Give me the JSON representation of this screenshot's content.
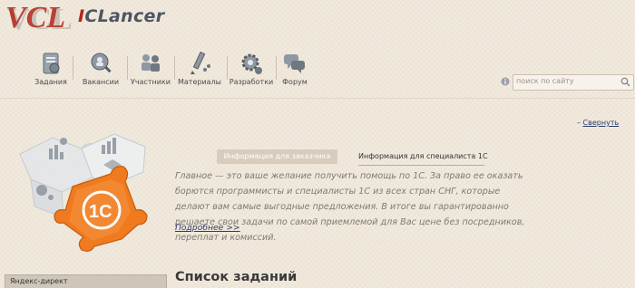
{
  "logo": {
    "text": "ICLancer",
    "first_letter": "I",
    "rest": "CLancer"
  },
  "nav": {
    "items": [
      {
        "label": "Задания",
        "icon": "tasks-icon"
      },
      {
        "label": "Вакансии",
        "icon": "vacancies-icon"
      },
      {
        "label": "Участники",
        "icon": "members-icon"
      },
      {
        "label": "Материалы",
        "icon": "materials-icon"
      },
      {
        "label": "Разработки",
        "icon": "gear-icon"
      },
      {
        "label": "Форум",
        "icon": "forum-icon"
      }
    ]
  },
  "search": {
    "placeholder": "поиск по сайту"
  },
  "collapse": {
    "prefix": "–",
    "label": "Свернуть"
  },
  "tabs": {
    "customer": "Информация для заказчика",
    "specialist": "Информация для специалиста 1С"
  },
  "promo": {
    "text": "Главное — это ваше желание получить помощь по 1С. За право ее оказать борются программисты и специалисты 1С из всех стран СНГ, которые делают вам самые выгодные предложения. В итоге вы гарантированно решаете свои задачи по самой приемлемой для Вас цене без посредников, переплат и комиссий.",
    "more": "Подробнее >>"
  },
  "sidebar": {
    "box_title": "Яндекс-директ"
  },
  "main": {
    "title": "Список заданий"
  },
  "colors": {
    "accent": "#b2261a",
    "link": "#2a3d6a",
    "puzzle": "#f07a1e",
    "background": "#efe7da"
  }
}
